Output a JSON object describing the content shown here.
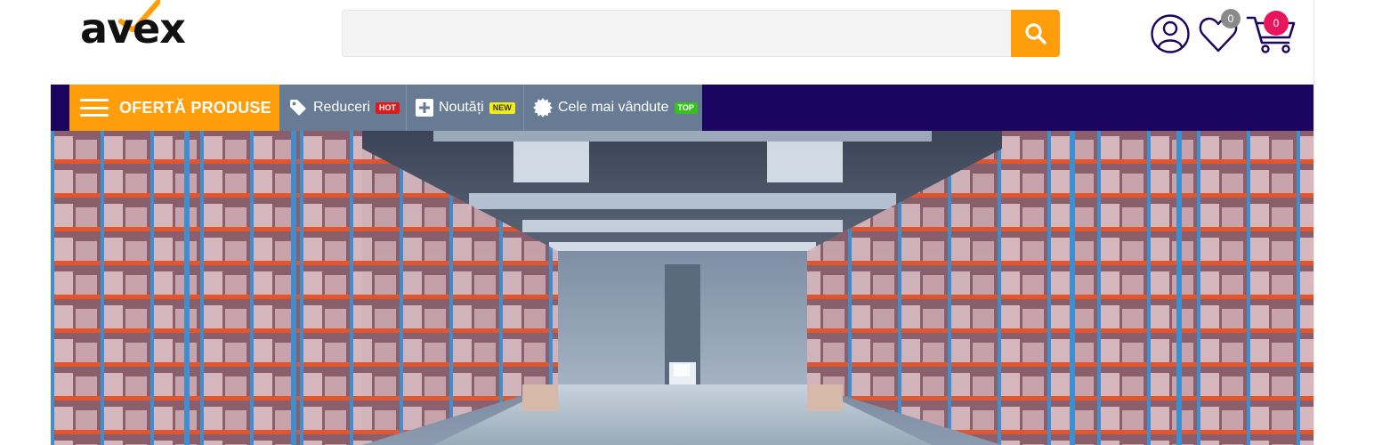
{
  "header": {
    "logo": {
      "text": "avex",
      "accent": "#ff9d0a"
    },
    "search": {
      "value": "",
      "placeholder": "",
      "button_icon": "search-icon",
      "button_color": "#ff9d0a"
    },
    "account_icon": "user-icon",
    "wishlist": {
      "icon": "heart-icon",
      "count": "0",
      "badge_color": "#8a8a8a"
    },
    "cart": {
      "icon": "cart-icon",
      "count": "0",
      "badge_color": "#e8155d"
    }
  },
  "nav": {
    "background": "#1c0561",
    "offer": {
      "label": "OFERTĂ PRODUSE",
      "icon": "hamburger-icon",
      "color": "#ff9d0a"
    },
    "items": [
      {
        "label": "Reduceri",
        "icon": "tag-icon",
        "tag": "HOT",
        "tag_bg": "#e01a1a",
        "tag_fg": "#ffffff"
      },
      {
        "label": "Noutăți",
        "icon": "plus-square-icon",
        "tag": "NEW",
        "tag_bg": "#f2ee12",
        "tag_fg": "#333333"
      },
      {
        "label": "Cele mai vândute",
        "icon": "badge-star-icon",
        "tag": "TOP",
        "tag_bg": "#35c21c",
        "tag_fg": "#ffffff"
      }
    ]
  },
  "hero": {
    "image": "warehouse-banner"
  }
}
